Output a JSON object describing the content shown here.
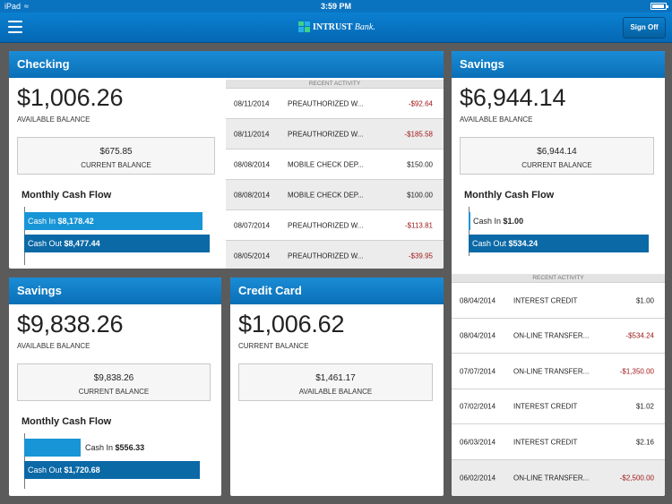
{
  "status": {
    "carrier": "iPad",
    "time": "3:59 PM"
  },
  "nav": {
    "logo_bold": "INTRUST",
    "logo_italic": "Bank.",
    "signoff_label": "Sign Off"
  },
  "checking": {
    "title": "Checking",
    "available_amount": "$1,006.26",
    "available_label": "AVAILABLE BALANCE",
    "current_amount": "$675.85",
    "current_label": "CURRENT BALANCE",
    "cashflow_title": "Monthly Cash Flow",
    "cash_in_label": "Cash In",
    "cash_in_value": "$8,178.42",
    "cash_in_fraction": 0.966,
    "cash_out_label": "Cash Out",
    "cash_out_value": "$8,477.44",
    "cash_out_fraction": 1.0,
    "activity_header": "RECENT ACTIVITY",
    "activity": [
      {
        "date": "08/11/2014",
        "desc": "PREAUTHORIZED W...",
        "amount": "-$92.64",
        "negative": true
      },
      {
        "date": "08/11/2014",
        "desc": "PREAUTHORIZED W...",
        "amount": "-$185.58",
        "negative": true
      },
      {
        "date": "08/08/2014",
        "desc": "MOBILE CHECK DEP...",
        "amount": "$150.00",
        "negative": false
      },
      {
        "date": "08/08/2014",
        "desc": "MOBILE CHECK DEP...",
        "amount": "$100.00",
        "negative": false
      },
      {
        "date": "08/07/2014",
        "desc": "PREAUTHORIZED W...",
        "amount": "-$113.81",
        "negative": true
      },
      {
        "date": "08/05/2014",
        "desc": "PREAUTHORIZED W...",
        "amount": "-$39.95",
        "negative": true
      }
    ]
  },
  "savings_top": {
    "title": "Savings",
    "available_amount": "$6,944.14",
    "available_label": "AVAILABLE BALANCE",
    "current_amount": "$6,944.14",
    "current_label": "CURRENT BALANCE",
    "cashflow_title": "Monthly Cash Flow",
    "cash_in_label": "Cash In",
    "cash_in_value": "$1.00",
    "cash_in_fraction": 0.002,
    "cash_out_label": "Cash Out",
    "cash_out_value": "$534.24",
    "cash_out_fraction": 1.0,
    "activity_header": "RECENT ACTIVITY",
    "activity": [
      {
        "date": "08/04/2014",
        "desc": "INTEREST CREDIT",
        "amount": "$1.00",
        "negative": false
      },
      {
        "date": "08/04/2014",
        "desc": "ON-LINE TRANSFER...",
        "amount": "-$534.24",
        "negative": true
      },
      {
        "date": "07/07/2014",
        "desc": "ON-LINE TRANSFER...",
        "amount": "-$1,350.00",
        "negative": true
      },
      {
        "date": "07/02/2014",
        "desc": "INTEREST CREDIT",
        "amount": "$1.02",
        "negative": false
      },
      {
        "date": "06/03/2014",
        "desc": "INTEREST CREDIT",
        "amount": "$2.16",
        "negative": false
      },
      {
        "date": "06/02/2014",
        "desc": "ON-LINE TRANSFER...",
        "amount": "-$2,500.00",
        "negative": true
      }
    ]
  },
  "savings_bottom": {
    "title": "Savings",
    "available_amount": "$9,838.26",
    "available_label": "AVAILABLE BALANCE",
    "current_amount": "$9,838.26",
    "current_label": "CURRENT BALANCE",
    "cashflow_title": "Monthly Cash Flow",
    "cash_in_label": "Cash In",
    "cash_in_value": "$556.33",
    "cash_in_fraction": 0.323,
    "cash_out_label": "Cash Out",
    "cash_out_value": "$1,720.68",
    "cash_out_fraction": 1.0
  },
  "credit_card": {
    "title": "Credit Card",
    "current_amount": "$1,006.62",
    "current_label": "CURRENT BALANCE",
    "available_amount": "$1,461.17",
    "available_label": "AVAILABLE BALANCE"
  }
}
